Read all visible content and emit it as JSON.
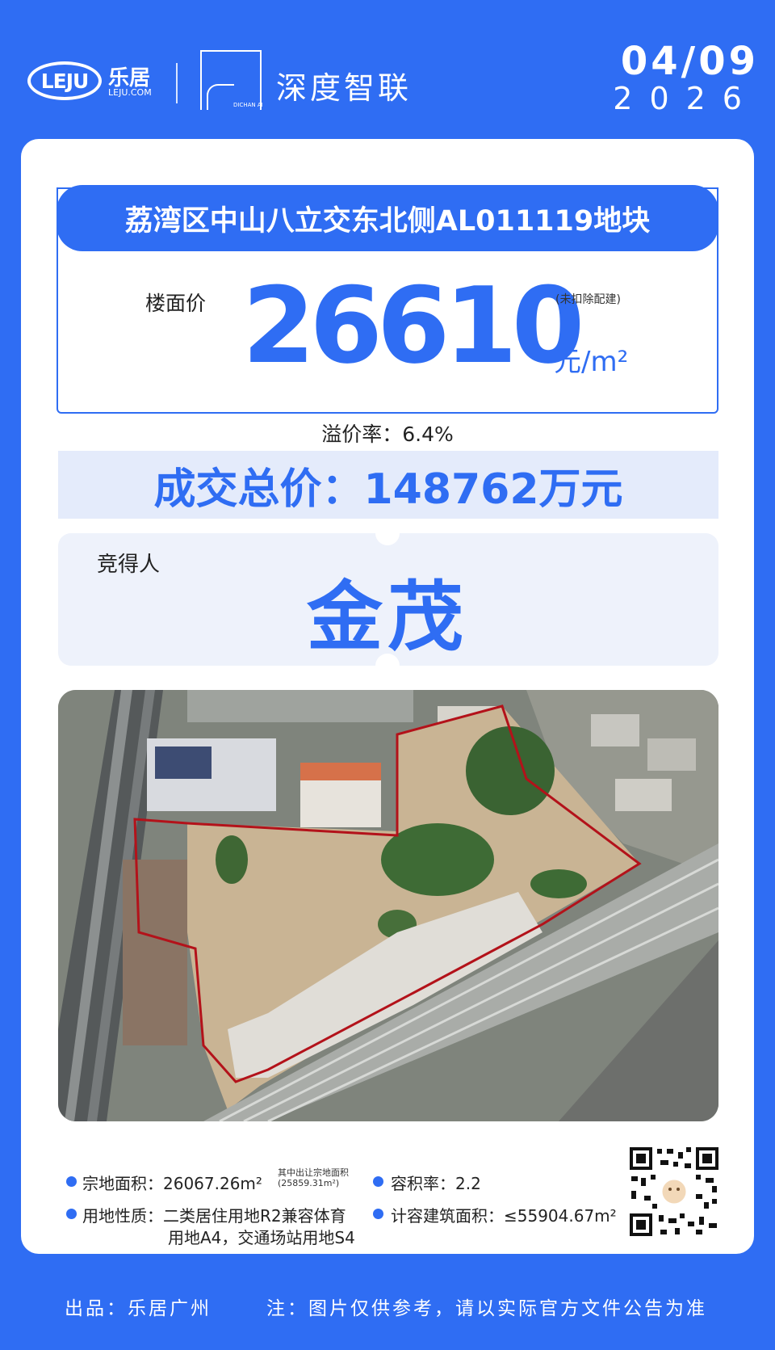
{
  "header": {
    "logo_mark": "LEJU",
    "logo_cn": "乐居",
    "logo_url": "LEJU.COM",
    "partner_mark_text": "DICHAN AI",
    "partner_name": "深度智联",
    "date_md": "04/09",
    "date_year": "2026"
  },
  "plot": {
    "title": "荔湾区中山八立交东北侧AL011119地块",
    "floor_price_label": "楼面价",
    "floor_price": "26610",
    "floor_price_note": "(未扣除配建)",
    "floor_price_unit": "元/m²",
    "premium_rate": "溢价率：6.4%",
    "total_price": "成交总价：148762万元",
    "winner_label": "竞得人",
    "winner": "金茂"
  },
  "details": {
    "site_area": "宗地面积：26067.26m²",
    "site_area_note_1": "其中出让宗地面积",
    "site_area_note_2": "(25859.31m²)",
    "far": "容积率：2.2",
    "land_use_1": "用地性质：二类居住用地R2兼容体育",
    "land_use_2": "用地A4，交通场站用地S4",
    "gfa": "计容建筑面积：≤55904.67m²"
  },
  "footer": {
    "producer": "出品：乐居广州",
    "disclaimer": "注：图片仅供参考，请以实际官方文件公告为准"
  },
  "colors": {
    "brand_blue": "#2f6df3",
    "plot_boundary": "#b3121a"
  }
}
